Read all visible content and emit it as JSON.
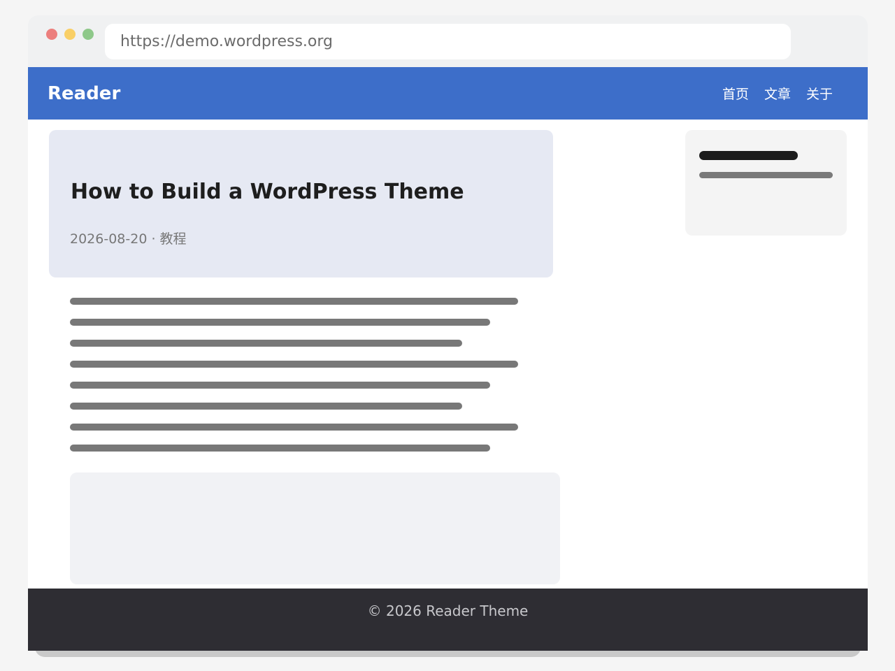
{
  "browser": {
    "url": "https://demo.wordpress.org"
  },
  "site": {
    "logo": "Reader",
    "nav": [
      {
        "label": "首页"
      },
      {
        "label": "文章"
      },
      {
        "label": "关于"
      }
    ]
  },
  "post": {
    "title": "How to Build a WordPress Theme",
    "meta": "2026-08-20 · 教程"
  },
  "footer": {
    "text": "© 2026 Reader Theme"
  },
  "colors": {
    "header": "#3d6ec9",
    "hero": "#e6e9f3",
    "footer": "#2e2d33"
  }
}
